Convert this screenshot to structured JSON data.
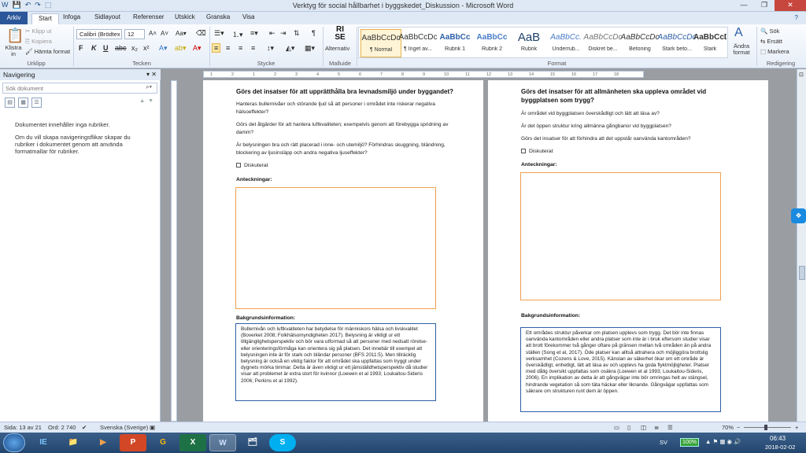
{
  "window": {
    "title": "Verktyg för social hållbarhet i byggskedet_Diskussion - Microsoft Word",
    "qat": [
      "W",
      "💾",
      "↶",
      "↷",
      "⬚"
    ],
    "controls": [
      "—",
      "❐",
      "✕"
    ]
  },
  "tabs": {
    "file": "Arkiv",
    "items": [
      "Start",
      "Infoga",
      "Sidlayout",
      "Referenser",
      "Utskick",
      "Granska",
      "Visa"
    ]
  },
  "ribbon": {
    "clipboard": {
      "paste": "Klistra in",
      "cut": "Klipp ut",
      "copy": "Kopiera",
      "format": "Hämta format",
      "label": "Urklipp"
    },
    "font": {
      "name": "Calibri (Brödtex",
      "size": "12",
      "label": "Tecken",
      "bold": "F",
      "italic": "K",
      "underline": "U"
    },
    "paragraph": {
      "label": "Stycke"
    },
    "alt": {
      "icon": "RI SE",
      "name": "Alternativ",
      "label": "Malluide"
    },
    "styles": {
      "label": "Format",
      "items": [
        {
          "preview": "AaBbCcDc",
          "name": "¶ Normal"
        },
        {
          "preview": "AaBbCcDc",
          "name": "¶ Inget av..."
        },
        {
          "preview": "AaBbCc",
          "name": "Rubrik 1"
        },
        {
          "preview": "AaBbCc",
          "name": "Rubrik 2"
        },
        {
          "preview": "AaB",
          "name": "Rubrik"
        },
        {
          "preview": "AaBbCc.",
          "name": "Underrub..."
        },
        {
          "preview": "AaBbCcDc",
          "name": "Diskret be..."
        },
        {
          "preview": "AaBbCcDc",
          "name": "Betoning"
        },
        {
          "preview": "AaBbCcDc",
          "name": "Stark beto..."
        },
        {
          "preview": "AaBbCcDc",
          "name": "Stark"
        }
      ],
      "change": "Ändra format"
    },
    "editing": {
      "find": "Sök",
      "replace": "Ersätt",
      "select": "Markera",
      "label": "Redigering"
    }
  },
  "nav": {
    "title": "Navigering",
    "search_placeholder": "Sök dokument",
    "msg1": "Dokumentet innehåller inga rubriker.",
    "msg2": "Om du vill skapa navigeringsflikar skapar du rubriker i dokumentet genom att använda formatmallar för rubriker."
  },
  "page1": {
    "heading": "Görs det insatser för att upprätthålla bra levnadsmiljö under byggandet?",
    "q1": "Hanteras bullernivåer och störande ljud så att personer i området inte riskerar negativa hälsoeffekter?",
    "q2": "Görs det åtgärder för att hantera luftkvaliteten; exempelvis genom att förebygga spridning av damm?",
    "q3": "Är belysningen bra och rätt placerad i inne- och utemiljö? Förhindras skuggning, bländning, blockering av ljusinsläpp och andra negativa ljuseffekter?",
    "check": "Diskuterat",
    "notes": "Anteckningar:",
    "bg_label": "Bakgrundsinformation:",
    "bg_text": "Bullernivån och luftkvaliteten har betydelse för människors hälsa och livskvalitet (Boverket 2008; Folkhälsomyndigheten 2017). Belysning är viktigt ur ett tillgänglighetsperspektiv och bör vara utformad så att personer med nedsatt rörelse- eller orienteringsförmåga kan orientera sig på platsen. Det innebär till exempel att belysningen inte är för stark och bländar personer (BFS 2011:5). Men tillräcklig belysning är också en viktig faktor för att området ska uppfattas som tryggt under dygnets mörka timmar. Detta är även viktigt ur ett jämställdhetsperspektiv då studier visar att problemet är extra stort för kvinnor (Loewen et al 1993; Loukaitou-Sideris 2006; Perkins et al 1992)."
  },
  "page2": {
    "heading": "Görs det insatser för att allmänheten ska uppleva området vid byggplatsen som trygg?",
    "q1": "Är området vid byggplatsen överskådligt och lätt att läsa av?",
    "q2": "Är det öppen struktur kring allmänna gångbanor vid byggplatsen?",
    "q3": "Görs det insatser för att förhindra att det uppstår oanvända kantområden?",
    "check": "Diskuterat",
    "notes": "Anteckningar:",
    "bg_label": "Bakgrundsinformation:",
    "bg_text": "Ett områdes struktur påverkar om platsen upplevs som trygg. Det bör inte finnas oanvända kantområden eller andra platser som inte är i bruk eftersom studier visar att brott förekommer två gånger oftare på gränsen mellan två områden än på andra ställen (Song et al, 2017). Öde platser kan alltså attrahera och möjliggöra brottslig verksamhet (Cozens & Love, 2015). Känslan av säkerhet ökar om ett område är överskådligt, enhetligt, lätt att läsa av och upplevs ha goda flyktmöjligheter. Platser med dålig översikt uppfattas som osäkra (Loewen et al 1993; Loukaitou-Sideris, 2006). En implikation av detta är att gångvägar inte bör omringas helt av stängsel, hindrande vegetation så som täta häckar eller liknande. Gångvägar uppfattas som säkrare om strukturen runt dem är öppen."
  },
  "ruler_ticks": [
    "1",
    "2",
    "1",
    "2",
    "3",
    "4",
    "5",
    "6",
    "7",
    "8",
    "9",
    "10",
    "11",
    "12",
    "13",
    "14",
    "15",
    "16",
    "17",
    "18"
  ],
  "status": {
    "page": "Sida: 13 av 21",
    "words": "Ord: 2 740",
    "lang": "Svenska (Sverige)",
    "zoom": "70%",
    "zoom_minus": "−",
    "zoom_plus": "+"
  },
  "taskbar": {
    "apps": [
      "IE",
      "📁",
      "▶",
      "P",
      "G",
      "X",
      "W",
      "🗂",
      "S"
    ],
    "lang": "SV",
    "battery": "100%",
    "time": "06:43",
    "date": "2018-02-02"
  }
}
